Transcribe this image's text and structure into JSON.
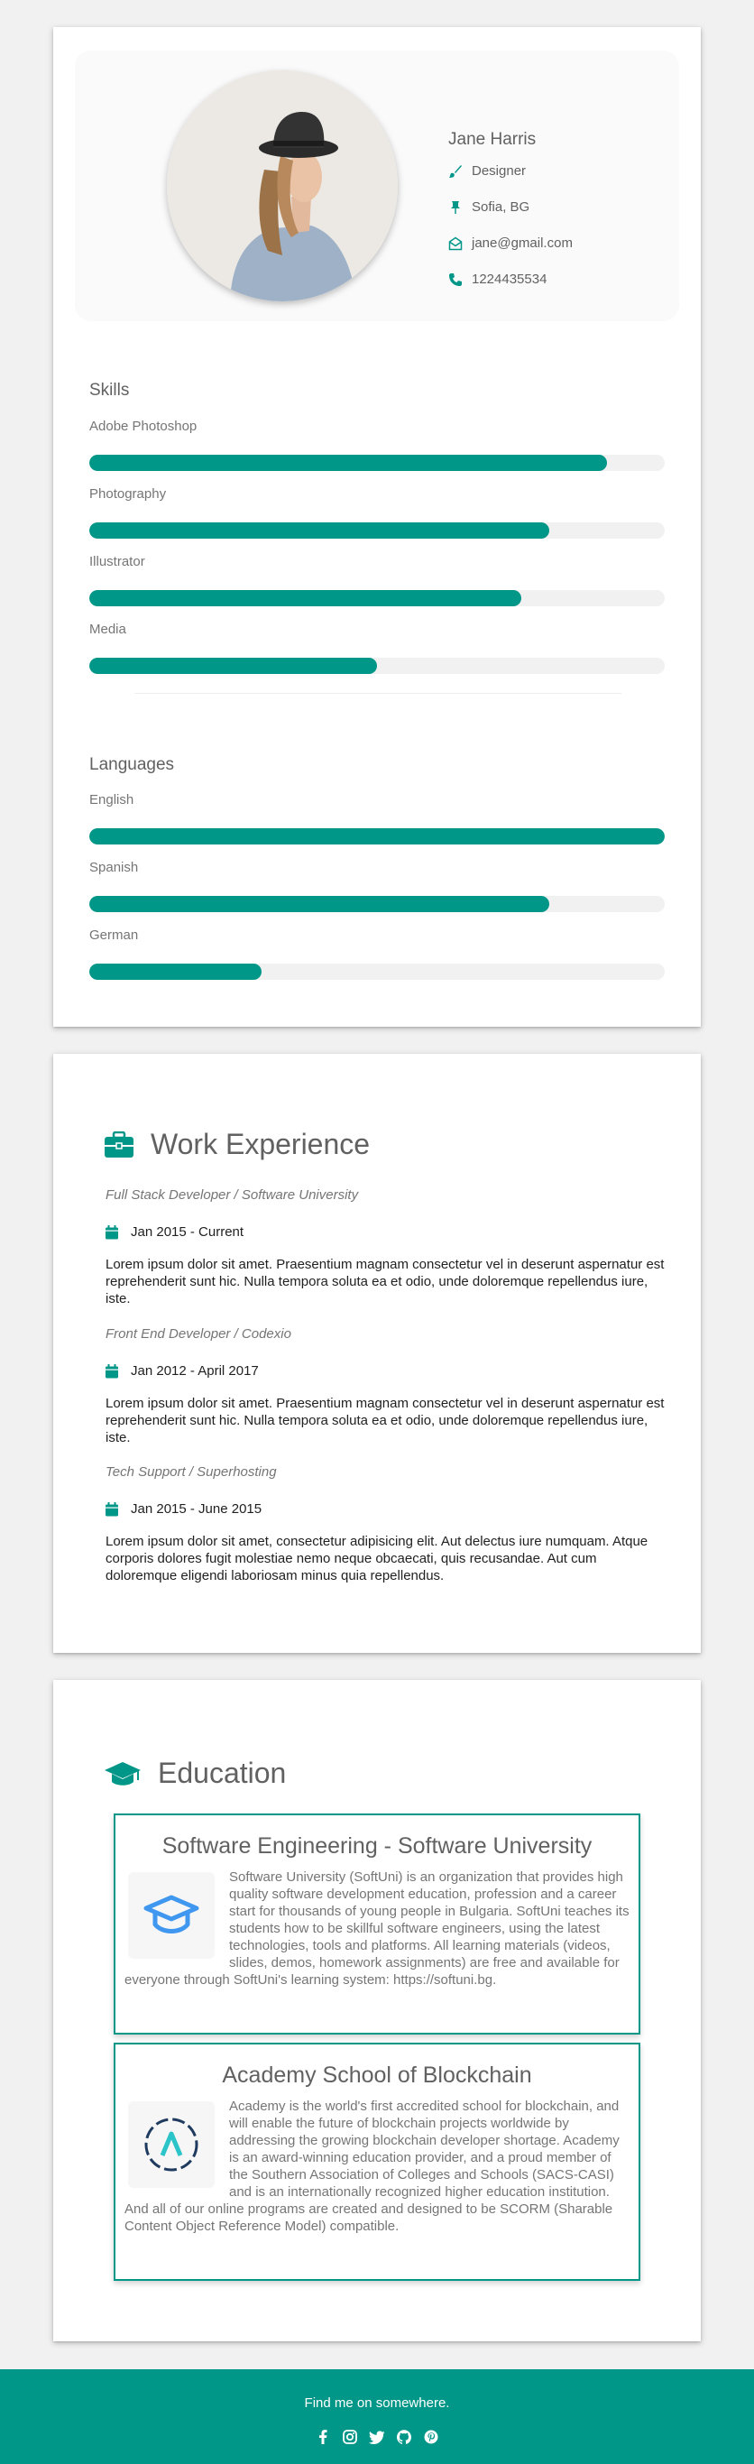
{
  "profile": {
    "name": "Jane Harris",
    "role": "Designer",
    "location": "Sofia, BG",
    "email": "jane@gmail.com",
    "phone": "1224435534",
    "icons": [
      "paint-brush-icon",
      "map-pin-icon",
      "envelope-icon",
      "phone-icon"
    ]
  },
  "skills": {
    "title": "Skills",
    "items": [
      {
        "label": "Adobe Photoshop",
        "percent": 90
      },
      {
        "label": "Photography",
        "percent": 80
      },
      {
        "label": "Illustrator",
        "percent": 75
      },
      {
        "label": "Media",
        "percent": 50
      }
    ]
  },
  "languages": {
    "title": "Languages",
    "items": [
      {
        "label": "English",
        "percent": 100
      },
      {
        "label": "Spanish",
        "percent": 80
      },
      {
        "label": "German",
        "percent": 30
      }
    ]
  },
  "experience": {
    "title": "Work Experience",
    "jobs": [
      {
        "title": "Full Stack Developer / Software University",
        "date": "Jan 2015 - Current",
        "desc": "Lorem ipsum dolor sit amet. Praesentium magnam consectetur vel in deserunt aspernatur est reprehenderit sunt hic. Nulla tempora soluta ea et odio, unde doloremque repellendus iure, iste."
      },
      {
        "title": "Front End Developer / Codexio",
        "date": "Jan 2012 - April 2017",
        "desc": "Lorem ipsum dolor sit amet. Praesentium magnam consectetur vel in deserunt aspernatur est reprehenderit sunt hic. Nulla tempora soluta ea et odio, unde doloremque repellendus iure, iste."
      },
      {
        "title": "Tech Support / Superhosting",
        "date": "Jan 2015 - June 2015",
        "desc": "Lorem ipsum dolor sit amet, consectetur adipisicing elit. Aut delectus iure numquam. Atque corporis dolores fugit molestiae nemo neque obcaecati, quis recusandae. Aut cum doloremque eligendi laboriosam minus quia repellendus."
      }
    ]
  },
  "education": {
    "title": "Education",
    "items": [
      {
        "heading": "Software Engineering - Software University",
        "text": "Software University (SoftUni) is an organization that provides high quality software development education, profession and a career start for thousands of young people in Bulgaria. SoftUni teaches its students how to be skillful software engineers, using the latest technologies, tools and platforms. All learning materials (videos, slides, demos, homework assignments) are free and available for everyone through SoftUni's learning system: https://softuni.bg."
      },
      {
        "heading": "Academy School of Blockchain",
        "text": "Academy is the world's first accredited school for blockchain, and will enable the future of blockchain projects worldwide by addressing the growing blockchain developer shortage. Academy is an award-winning education provider, and a proud member of the Southern Association of Colleges and Schools (SACS-CASI) and is an internationally recognized higher education institution. And all of our online programs are created and designed to be SCORM (Sharable Content Object Reference Model) compatible."
      }
    ]
  },
  "footer": {
    "text": "Find me on somewhere.",
    "socials": [
      "facebook-icon",
      "instagram-icon",
      "twitter-icon",
      "github-icon",
      "pinterest-icon"
    ]
  },
  "colors": {
    "accent": "#009688",
    "background": "#f1f1f1"
  }
}
